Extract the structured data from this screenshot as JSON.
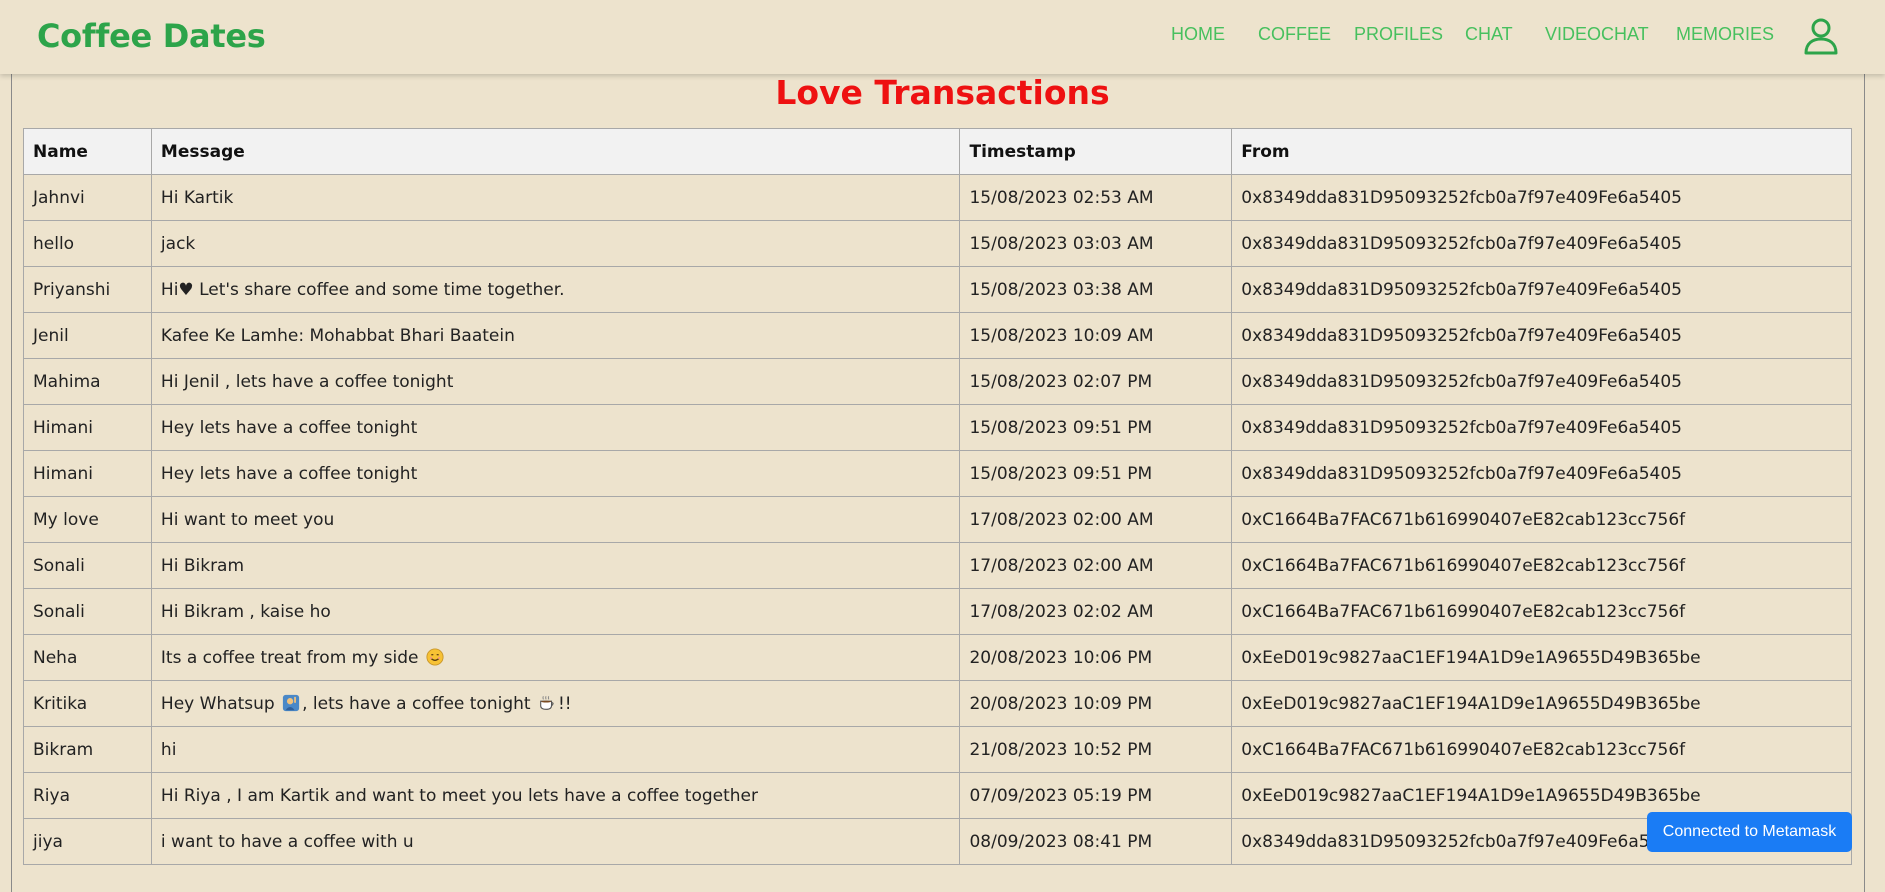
{
  "app": {
    "brand": "Coffee Dates"
  },
  "nav": [
    {
      "label": "HOME"
    },
    {
      "label": "COFFEE"
    },
    {
      "label": "PROFILES"
    },
    {
      "label": "CHAT"
    },
    {
      "label": "VIDEOCHAT"
    },
    {
      "label": "MEMORIES"
    }
  ],
  "page": {
    "title": "Love Transactions"
  },
  "table": {
    "headers": [
      "Name",
      "Message",
      "Timestamp",
      "From"
    ],
    "rows": [
      {
        "name": "Jahnvi",
        "message": "Hi Kartik",
        "timestamp": "15/08/2023 02:53 AM",
        "from": "0x8349dda831D95093252fcb0a7f97e409Fe6a5405"
      },
      {
        "name": "hello",
        "message": "jack",
        "timestamp": "15/08/2023 03:03 AM",
        "from": "0x8349dda831D95093252fcb0a7f97e409Fe6a5405"
      },
      {
        "name": "Priyanshi",
        "message": "Hi♥ Let's share coffee and some time together.",
        "timestamp": "15/08/2023 03:38 AM",
        "from": "0x8349dda831D95093252fcb0a7f97e409Fe6a5405"
      },
      {
        "name": "Jenil",
        "message": "Kafee Ke Lamhe: Mohabbat Bhari Baatein",
        "timestamp": "15/08/2023 10:09 AM",
        "from": "0x8349dda831D95093252fcb0a7f97e409Fe6a5405"
      },
      {
        "name": "Mahima",
        "message": "Hi Jenil , lets have a coffee tonight",
        "timestamp": "15/08/2023 02:07 PM",
        "from": "0x8349dda831D95093252fcb0a7f97e409Fe6a5405"
      },
      {
        "name": "Himani",
        "message": "Hey lets have a coffee tonight",
        "timestamp": "15/08/2023 09:51 PM",
        "from": "0x8349dda831D95093252fcb0a7f97e409Fe6a5405"
      },
      {
        "name": "Himani",
        "message": "Hey lets have a coffee tonight",
        "timestamp": "15/08/2023 09:51 PM",
        "from": "0x8349dda831D95093252fcb0a7f97e409Fe6a5405"
      },
      {
        "name": "My love",
        "message": "Hi want to meet you",
        "timestamp": "17/08/2023 02:00 AM",
        "from": "0xC1664Ba7FAC671b616990407eE82cab123cc756f"
      },
      {
        "name": "Sonali",
        "message": "Hi Bikram",
        "timestamp": "17/08/2023 02:00 AM",
        "from": "0xC1664Ba7FAC671b616990407eE82cab123cc756f"
      },
      {
        "name": "Sonali",
        "message": "Hi Bikram , kaise ho",
        "timestamp": "17/08/2023 02:02 AM",
        "from": "0xC1664Ba7FAC671b616990407eE82cab123cc756f"
      },
      {
        "name": "Neha",
        "message": "Its a coffee treat from my side",
        "message_emoji": "smiling-face",
        "timestamp": "20/08/2023 10:06 PM",
        "from": "0xEeD019c9827aaC1EF194A1D9e1A9655D49B365be"
      },
      {
        "name": "Kritika",
        "message_parts": [
          "Hey Whatsup ",
          ", lets have a coffee tonight ",
          "!!"
        ],
        "message_emojis": [
          "person-raising-hand",
          "hot-beverage"
        ],
        "timestamp": "20/08/2023 10:09 PM",
        "from": "0xEeD019c9827aaC1EF194A1D9e1A9655D49B365be"
      },
      {
        "name": "Bikram",
        "message": "hi",
        "timestamp": "21/08/2023 10:52 PM",
        "from": "0xC1664Ba7FAC671b616990407eE82cab123cc756f"
      },
      {
        "name": "Riya",
        "message": "Hi Riya , I am Kartik and want to meet you lets have a coffee together",
        "timestamp": "07/09/2023 05:19 PM",
        "from": "0xEeD019c9827aaC1EF194A1D9e1A9655D49B365be"
      },
      {
        "name": "jiya",
        "message": "i want to have a coffee with u",
        "timestamp": "08/09/2023 08:41 PM",
        "from": "0x8349dda831D95093252fcb0a7f97e409Fe6a5405"
      }
    ]
  },
  "status": {
    "metamask": "Connected to Metamask"
  },
  "colors": {
    "brand": "#2da44a",
    "nav": "#47c05e",
    "title": "#ee1111",
    "background": "#ede3cd",
    "button": "#1a7cf5"
  },
  "icons": {
    "user": "user-icon"
  }
}
